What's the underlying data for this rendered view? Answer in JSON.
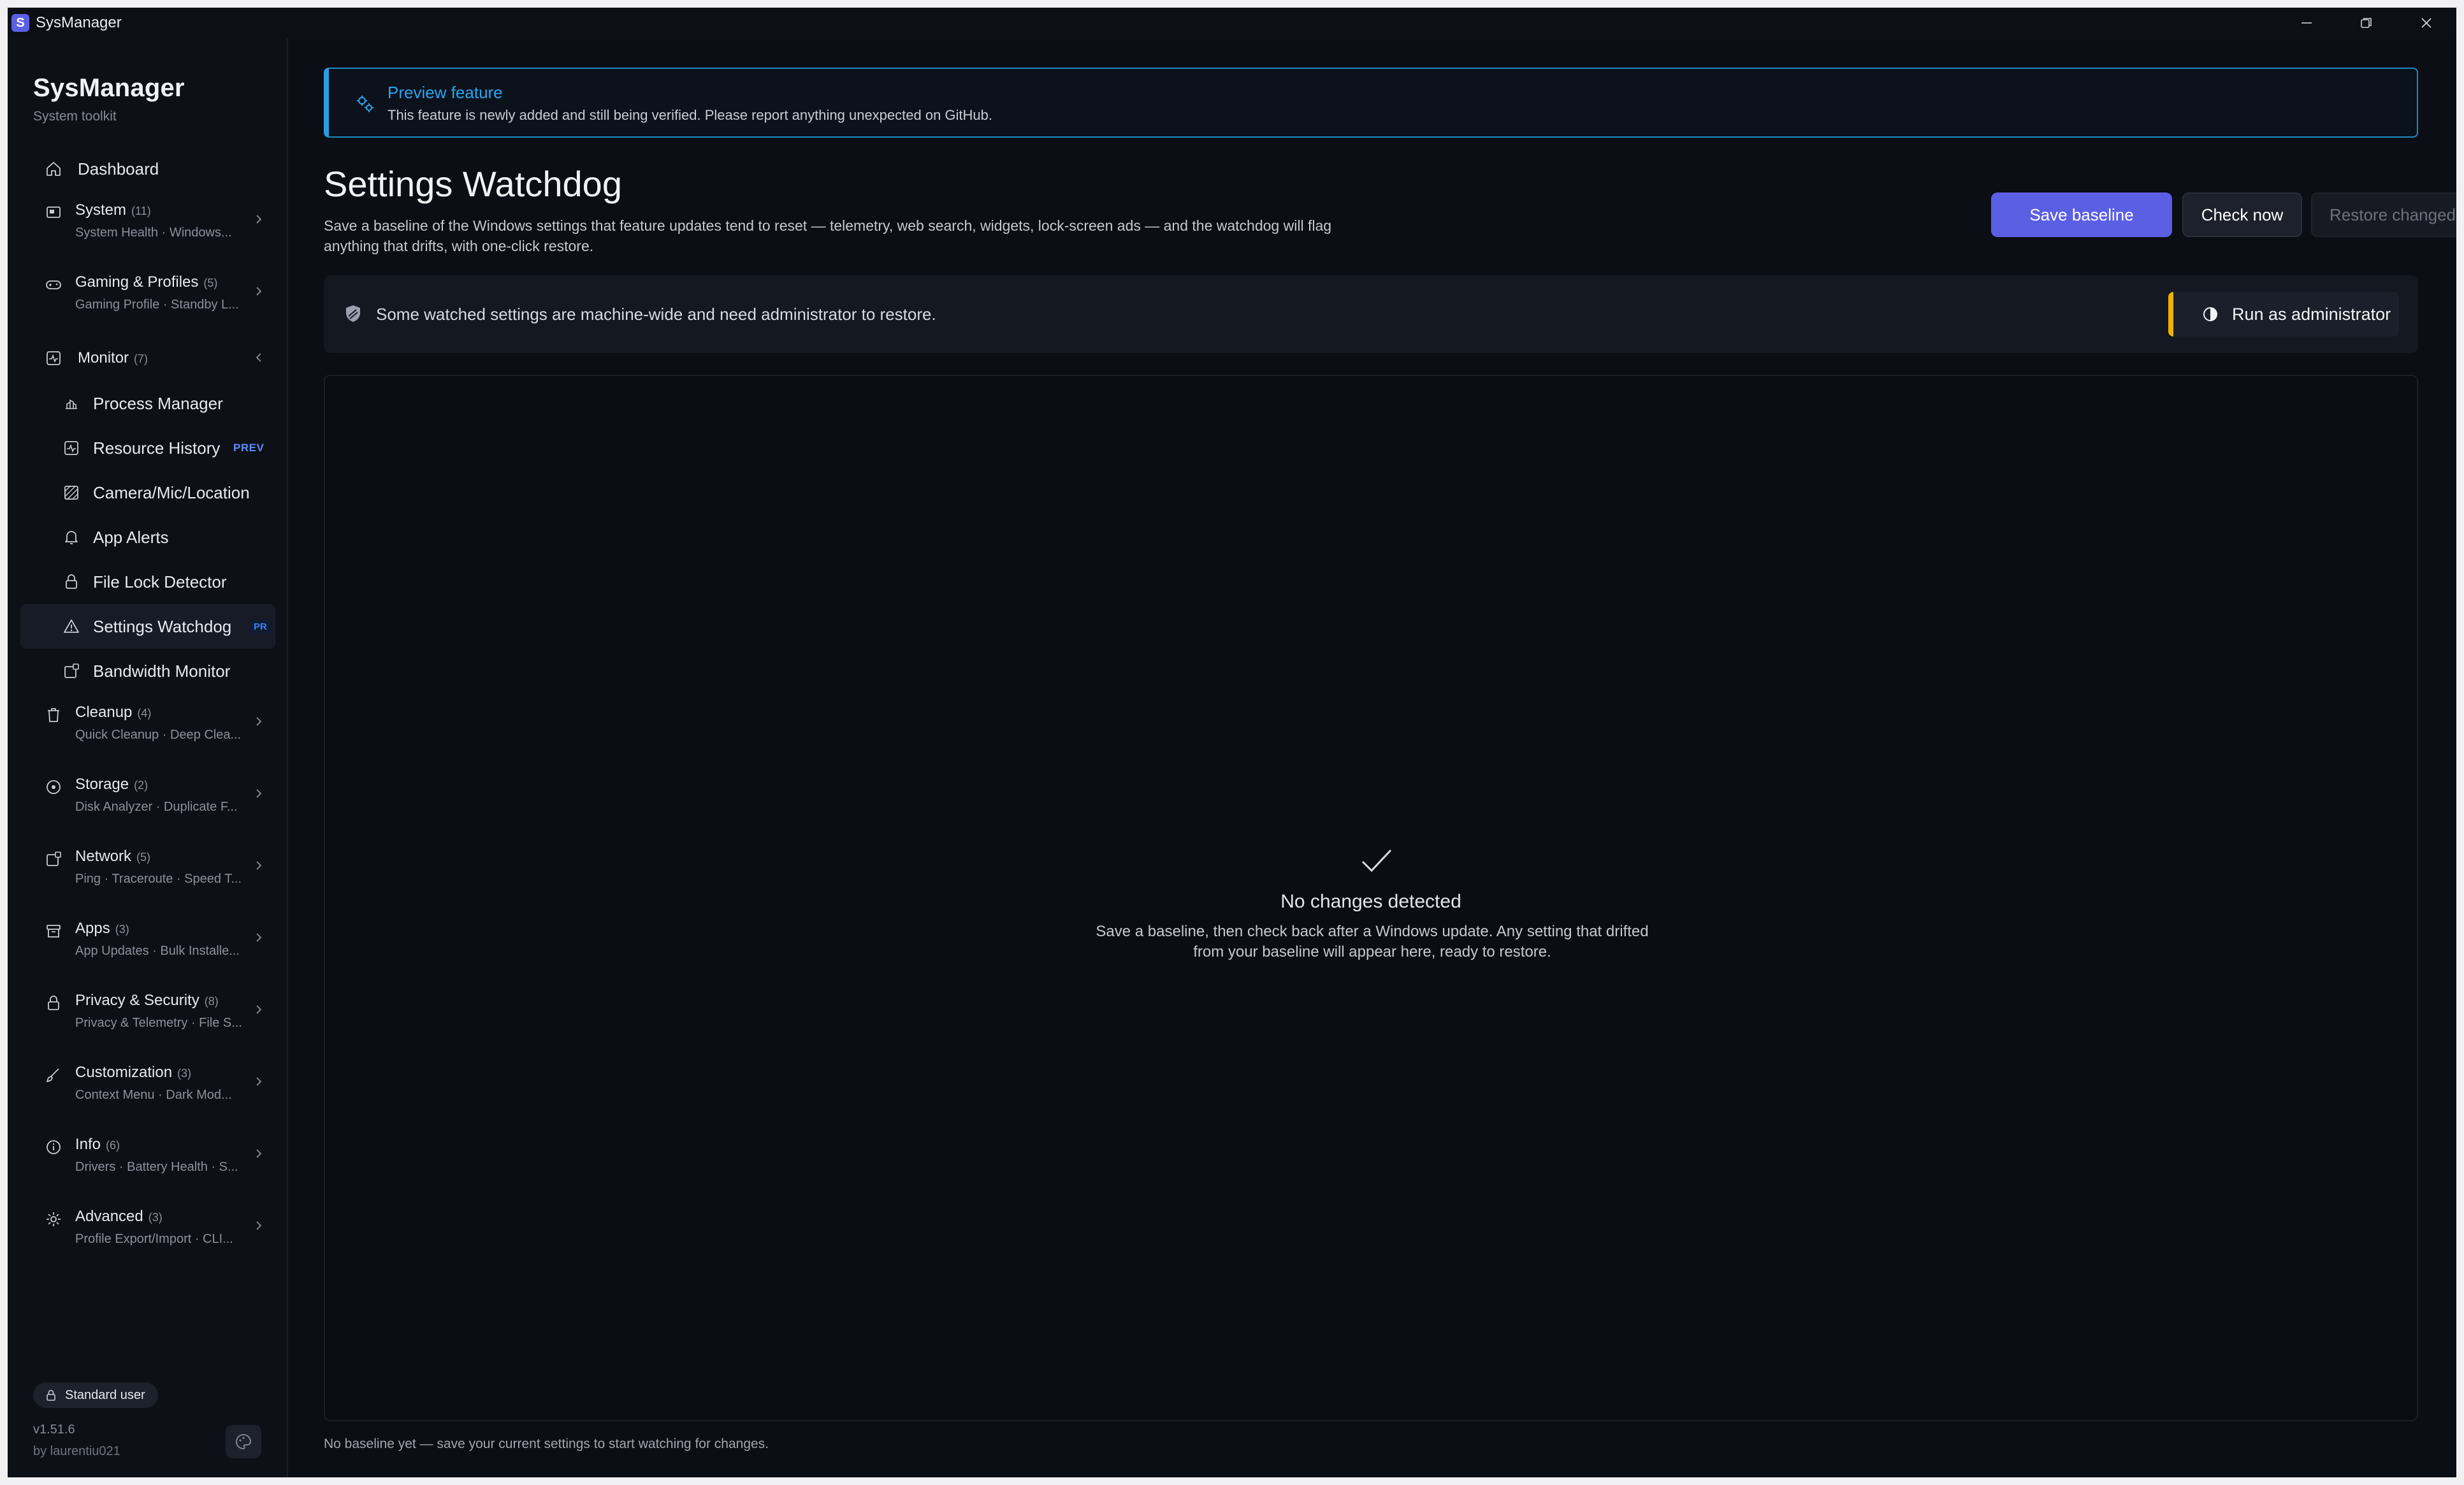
{
  "window": {
    "title": "SysManager",
    "icon_letter": "S"
  },
  "sidebar": {
    "brand_title": "SysManager",
    "brand_subtitle": "System toolkit",
    "dashboard_label": "Dashboard",
    "groups_top": [
      {
        "title": "System",
        "count": "(11)",
        "sub": "System Health · Windows...",
        "icon": "system-icon"
      },
      {
        "title": "Gaming & Profiles",
        "count": "(5)",
        "sub": "Gaming Profile · Standby L...",
        "icon": "gamepad-icon"
      }
    ],
    "monitor": {
      "title": "Monitor",
      "count": "(7)",
      "items": [
        {
          "label": "Process Manager",
          "icon": "process-icon"
        },
        {
          "label": "Resource History",
          "icon": "history-icon",
          "badge": "PREV"
        },
        {
          "label": "Camera/Mic/Location",
          "icon": "camera-icon"
        },
        {
          "label": "App Alerts",
          "icon": "bell-icon"
        },
        {
          "label": "File Lock Detector",
          "icon": "lock-icon"
        },
        {
          "label": "Settings Watchdog",
          "icon": "warning-icon",
          "badge": "PR",
          "active": true
        },
        {
          "label": "Bandwidth Monitor",
          "icon": "bandwidth-icon"
        }
      ]
    },
    "groups_bottom": [
      {
        "title": "Cleanup",
        "count": "(4)",
        "sub": "Quick Cleanup · Deep Clea...",
        "icon": "trash-icon"
      },
      {
        "title": "Storage",
        "count": "(2)",
        "sub": "Disk Analyzer · Duplicate F...",
        "icon": "disk-icon"
      },
      {
        "title": "Network",
        "count": "(5)",
        "sub": "Ping · Traceroute · Speed T...",
        "icon": "network-icon"
      },
      {
        "title": "Apps",
        "count": "(3)",
        "sub": "App Updates · Bulk Installe...",
        "icon": "apps-icon"
      },
      {
        "title": "Privacy & Security",
        "count": "(8)",
        "sub": "Privacy & Telemetry · File S...",
        "icon": "privacy-icon"
      },
      {
        "title": "Customization",
        "count": "(3)",
        "sub": "Context Menu · Dark Mod...",
        "icon": "brush-icon"
      },
      {
        "title": "Info",
        "count": "(6)",
        "sub": "Drivers · Battery Health · S...",
        "icon": "info-icon"
      },
      {
        "title": "Advanced",
        "count": "(3)",
        "sub": "Profile Export/Import · CLI...",
        "icon": "gear-icon"
      }
    ],
    "user_badge": "Standard user",
    "version": "v1.51.6",
    "author": "by laurentiu021"
  },
  "main": {
    "preview_title": "Preview feature",
    "preview_text": "This feature is newly added and still being verified. Please report anything unexpected on GitHub.",
    "page_title": "Settings Watchdog",
    "page_desc": "Save a baseline of the Windows settings that feature updates tend to reset — telemetry, web search, widgets, lock-screen ads — and the watchdog will flag anything that drifts, with one-click restore.",
    "buttons": {
      "save_baseline": "Save baseline",
      "check_now": "Check now",
      "restore_changed": "Restore changed"
    },
    "admin_notice": "Some watched settings are machine-wide and need administrator to restore.",
    "run_admin": "Run as administrator",
    "empty_title": "No changes detected",
    "empty_text": "Save a baseline, then check back after a Windows update. Any setting that drifted from your baseline will appear here, ready to restore.",
    "footer_note": "No baseline yet — save your current settings to start watching for changes."
  },
  "colors": {
    "accent": "#5b5fe4",
    "info_blue": "#2aa5f0",
    "warning_yellow": "#f2b000",
    "background": "#0b0e14"
  }
}
